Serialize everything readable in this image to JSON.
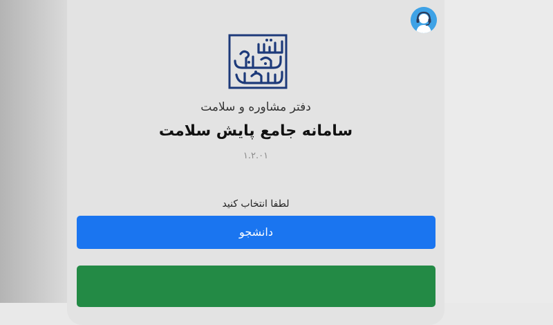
{
  "header": {
    "subtitle": "دفتر مشاوره و سلامت",
    "title": "سامانه جامع پایش سلامت",
    "version": "۱.۲.۰۱"
  },
  "logo": {
    "text_lines": [
      "سازمان",
      "امور دانشجویان"
    ]
  },
  "selection": {
    "prompt": "لطفا انتخاب کنید",
    "student_button": "دانشجو",
    "second_button": ""
  },
  "colors": {
    "primary": "#1a75f0",
    "success": "#238a45",
    "logo_blue": "#1d3a7a",
    "support_icon_bg": "#3ea2e6"
  },
  "icons": {
    "support": "headset-support-icon",
    "logo": "organization-emblem-logo"
  }
}
